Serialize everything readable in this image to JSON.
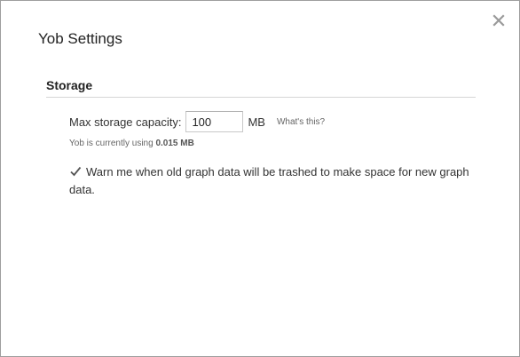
{
  "dialog": {
    "title": "Yob Settings",
    "close_icon": "close-icon"
  },
  "storage": {
    "section_title": "Storage",
    "max_capacity_label": "Max storage capacity:",
    "max_capacity_value": "100",
    "unit": "MB",
    "whats_this_link": "What's this?",
    "usage_prefix": "Yob is currently using",
    "usage_value": "0.015 MB",
    "warn_checked": true,
    "warn_label": "Warn me when old graph data will be trashed to make space for new graph data."
  },
  "colors": {
    "text": "#333333",
    "muted": "#666666",
    "divider": "#d6d6d6",
    "border": "#9e9e9e"
  }
}
